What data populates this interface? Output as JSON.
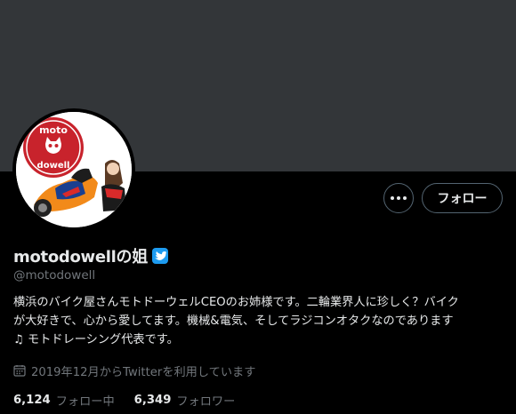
{
  "profile": {
    "display_name": "motodowellの姐",
    "handle": "@motodowell",
    "verified": true,
    "bio_lines": [
      "横浜のバイク屋さんモトドーウェルCEOのお姉様です。二輪業界人に珍しく？バイク",
      "が大好きで、心から愛してます。機械&電気、そしてラジコンオタクなのであります",
      "♫ モトドレーシング代表です。"
    ],
    "joined": "2019年12月からTwitterを利用しています",
    "following_count": "6,124",
    "following_label": "フォロー中",
    "followers_count": "6,349",
    "followers_label": "フォロワー",
    "avatar_logo_text": [
      "moto",
      "dowell"
    ]
  },
  "actions": {
    "more_label": "…",
    "follow_label": "フォロー"
  },
  "colors": {
    "banner": "#333639",
    "background": "#000000",
    "accent": "#1d9bf0",
    "logo_red": "#c8232c"
  },
  "icons": {
    "verified": "verified-badge-icon",
    "calendar": "calendar-icon",
    "more": "more-dots-icon"
  }
}
